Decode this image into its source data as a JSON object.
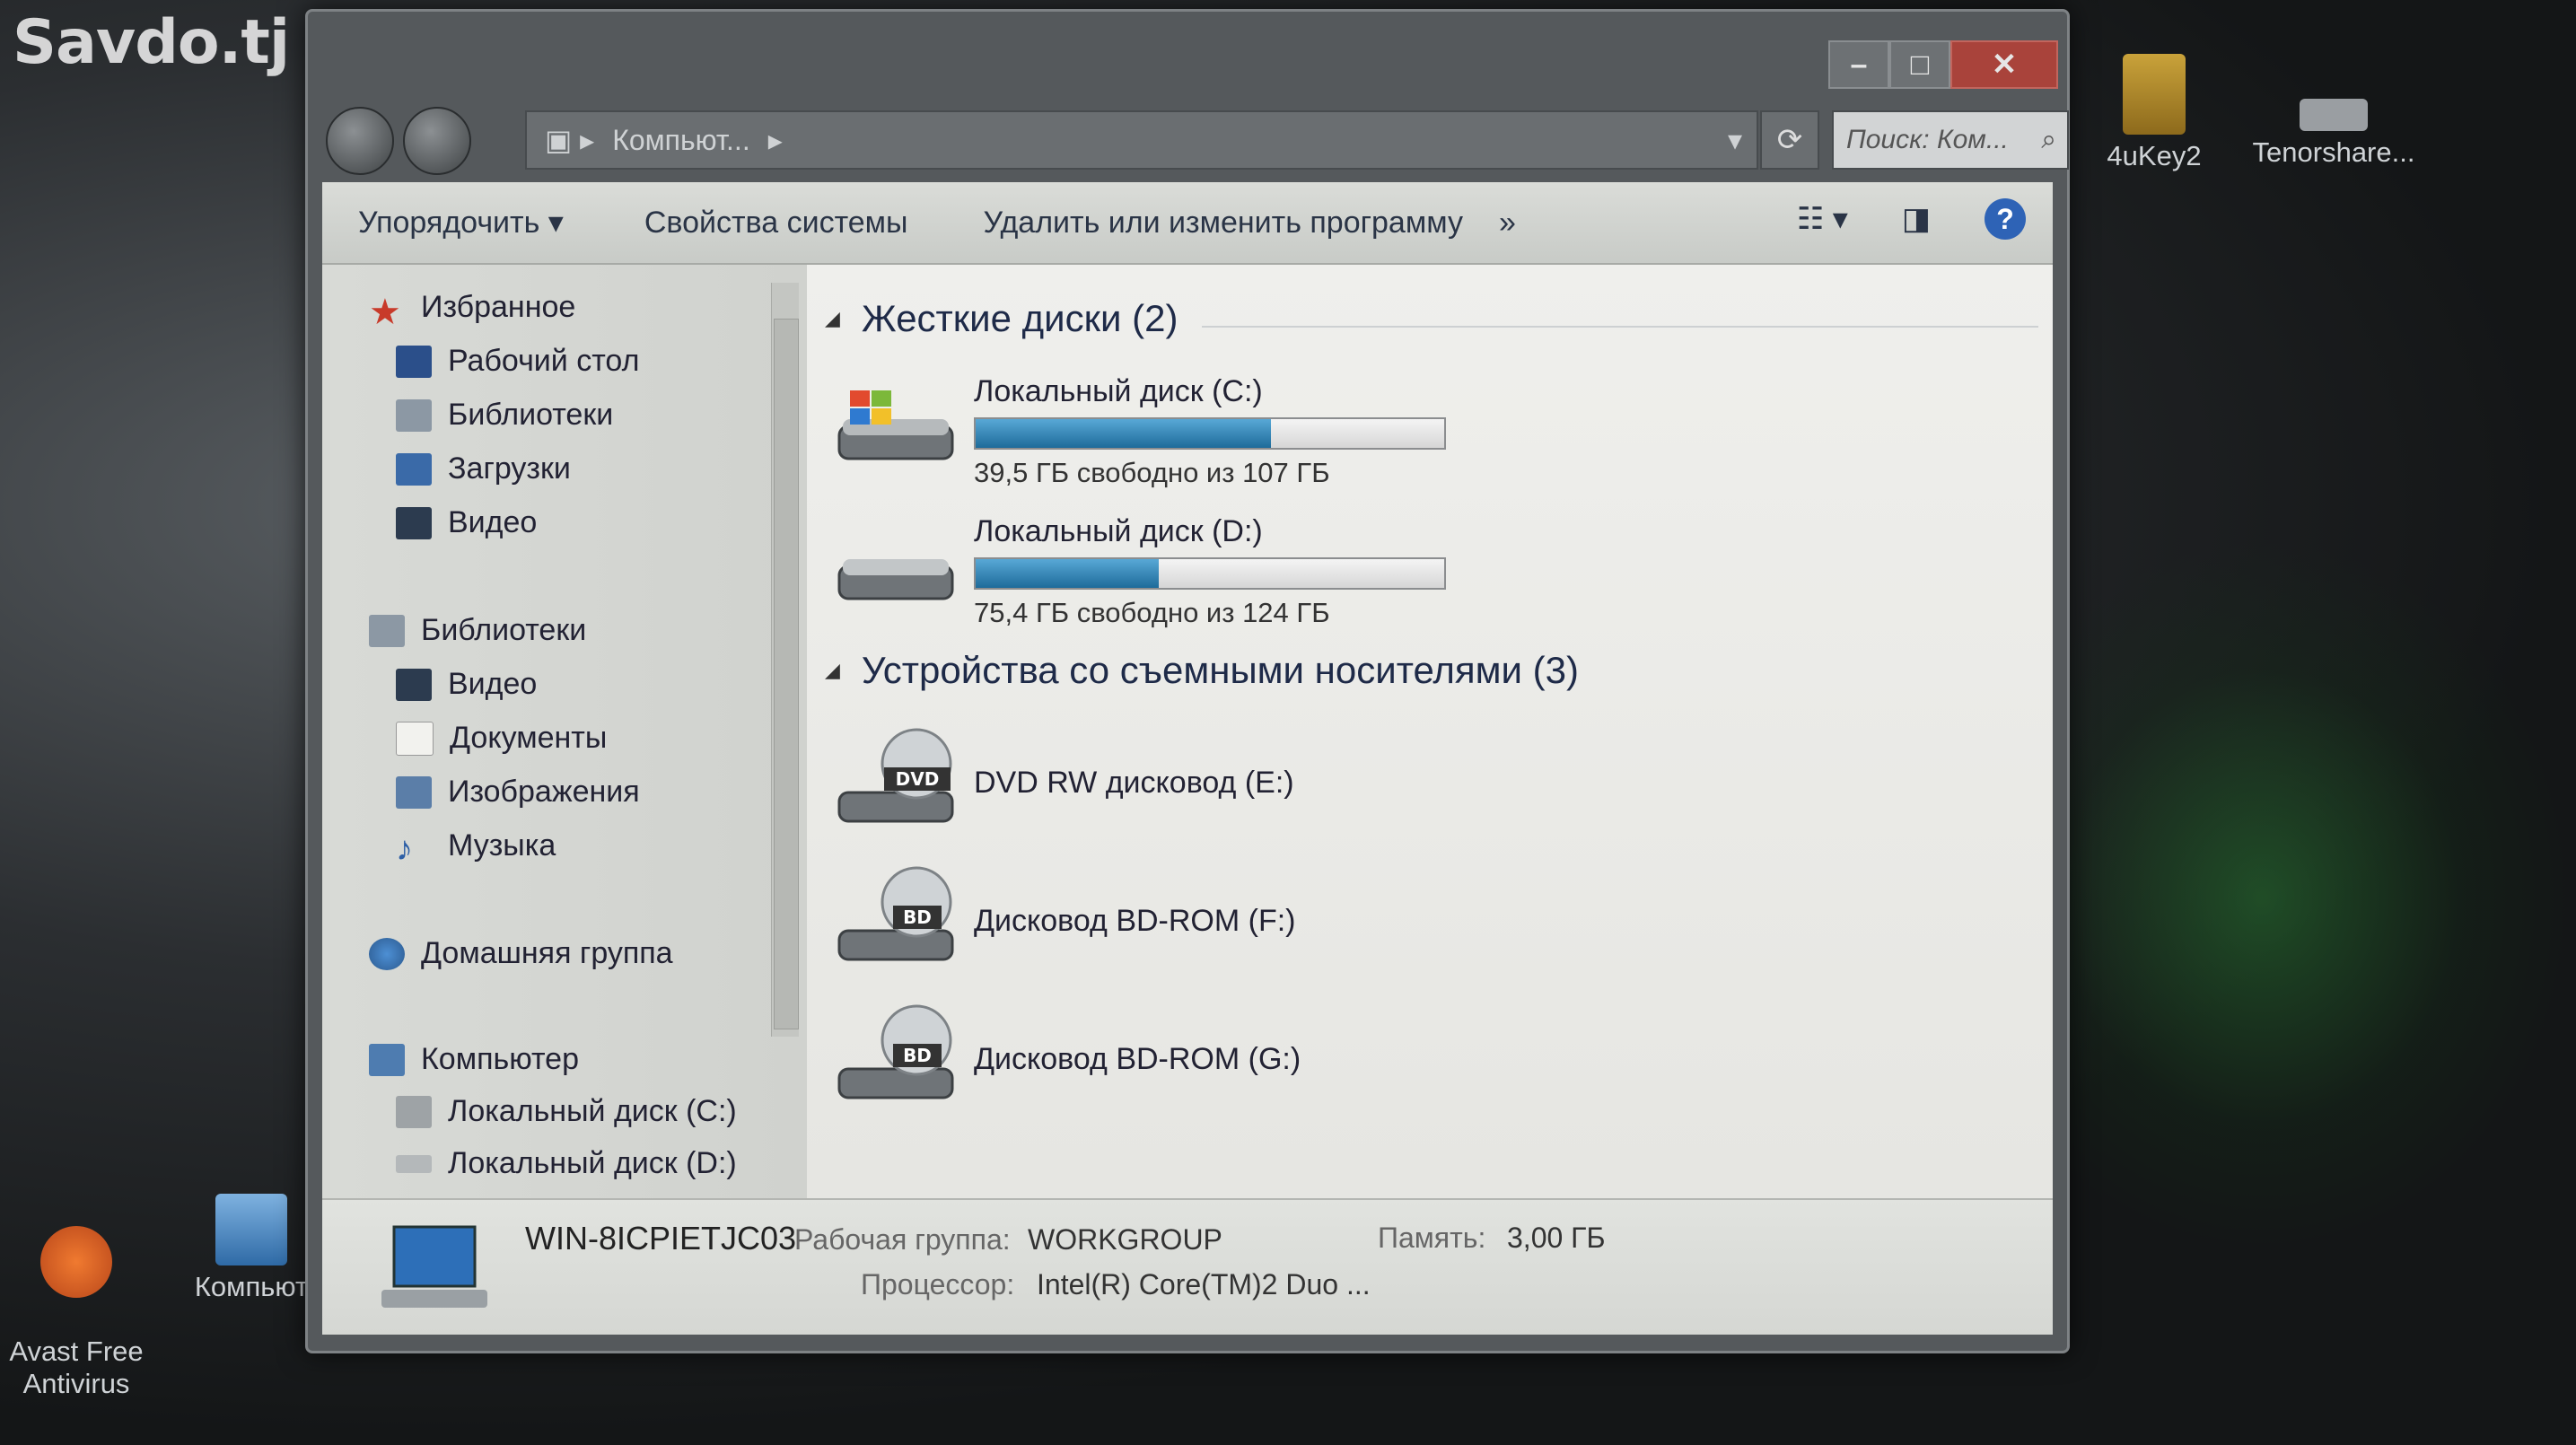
{
  "watermark": "Savdo.tj",
  "desktop": {
    "icons": [
      {
        "name": "folder-4ukey2",
        "label": "4uKey2"
      },
      {
        "name": "tenorshare",
        "label": "Tenorshare..."
      },
      {
        "name": "avast",
        "label": "Avast Free\nAntivirus"
      },
      {
        "name": "computer-shortcut",
        "label": "Компьют"
      }
    ]
  },
  "window": {
    "address": "Компьют...",
    "search_placeholder": "Поиск: Ком...",
    "caption": {
      "minimize": "–",
      "maximize": "□",
      "close": "✕"
    },
    "toolbar": {
      "organize": "Упорядочить ▾",
      "system_properties": "Свойства системы",
      "uninstall": "Удалить или изменить программу",
      "more": "»",
      "help": "?"
    },
    "nav": {
      "favorites": "Избранное",
      "desktop": "Рабочий стол",
      "libraries_fav": "Библиотеки",
      "downloads": "Загрузки",
      "video_fav": "Видео",
      "libraries": "Библиотеки",
      "video": "Видео",
      "documents": "Документы",
      "pictures": "Изображения",
      "music": "Музыка",
      "homegroup": "Домашняя группа",
      "computer": "Компьютер",
      "disk_c": "Локальный диск (C:)",
      "disk_d": "Локальный диск (D:)"
    },
    "content": {
      "hard_drives_header": "Жесткие диски (2)",
      "removable_header": "Устройства со съемными носителями (3)",
      "drives": [
        {
          "name": "Локальный диск (C:)",
          "info": "39,5 ГБ свободно из 107 ГБ",
          "used_fraction": 0.63
        },
        {
          "name": "Локальный диск (D:)",
          "info": "75,4 ГБ свободно из 124 ГБ",
          "used_fraction": 0.39
        }
      ],
      "removable": [
        {
          "name": "DVD RW дисковод (E:)",
          "badge": "DVD"
        },
        {
          "name": "Дисковод BD-ROM (F:)",
          "badge": "BD"
        },
        {
          "name": "Дисковод BD-ROM (G:)",
          "badge": "BD"
        }
      ]
    },
    "details": {
      "computer_name": "WIN-8ICPIETJC03",
      "workgroup_label": "Рабочая группа:",
      "workgroup_value": "WORKGROUP",
      "memory_label": "Память:",
      "memory_value": "3,00 ГБ",
      "cpu_label": "Процессор:",
      "cpu_value": "Intel(R) Core(TM)2 Duo ..."
    }
  },
  "colors": {
    "bar_fill": "#1e6b9a",
    "close_button": "#a9433b",
    "help": "#2e63b6"
  }
}
